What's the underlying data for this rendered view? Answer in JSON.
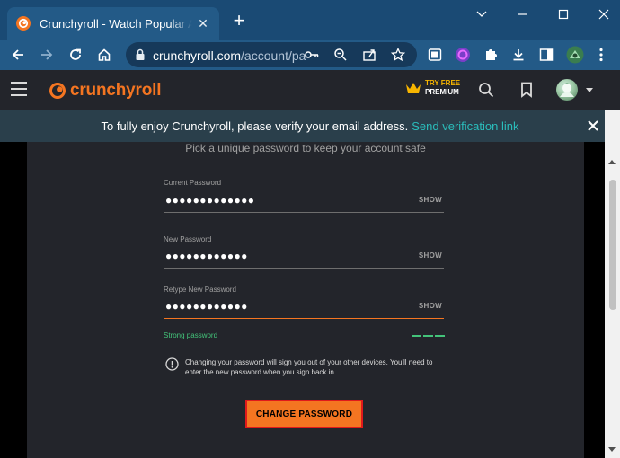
{
  "browser": {
    "tab": {
      "title": "Crunchyroll - Watch Popular Anime",
      "close_glyph": "✕",
      "favicon": "crunchyroll-favicon"
    },
    "new_tab_glyph": "+",
    "url": {
      "host": "crunchyroll.com",
      "path": "/account/password"
    },
    "window_controls": [
      "chevron-down-icon",
      "minimize-icon",
      "maximize-icon",
      "close-icon"
    ],
    "toolbar_icons": [
      "back-icon",
      "forward-icon",
      "reload-icon",
      "home-icon"
    ],
    "omnibox_icons": [
      "key-icon",
      "zoom-icon",
      "share-icon",
      "bookmark-star-icon"
    ],
    "extension_icons": [
      "extension-icon",
      "extension-purple-icon",
      "puzzle-icon",
      "download-icon",
      "sidepanel-icon",
      "profile-icon",
      "kebab-menu-icon"
    ],
    "colors": {
      "frame": "#1a4a74",
      "toolbar": "#235a87",
      "omnibox": "#16395a"
    }
  },
  "site": {
    "brand": "crunchyroll",
    "try_free_line1": "TRY FREE",
    "try_free_line2": "PREMIUM",
    "colors": {
      "accent": "#f47521",
      "header_bg": "#23252b",
      "premium": "#f7b500"
    }
  },
  "banner": {
    "text": "To fully enjoy Crunchyroll, please verify your email address.",
    "link": "Send verification link",
    "link_color": "#2abdbb"
  },
  "form": {
    "subtitle": "Pick a unique password to keep your account safe",
    "fields": [
      {
        "label": "Current Password",
        "value": "●●●●●●●●●●●●●",
        "toggle": "SHOW"
      },
      {
        "label": "New Password",
        "value": "●●●●●●●●●●●●",
        "toggle": "SHOW"
      },
      {
        "label": "Retype New Password",
        "value": "●●●●●●●●●●●●",
        "toggle": "SHOW"
      }
    ],
    "strength_label": "Strong password",
    "strength_color": "#43c47a",
    "info_text": "Changing your password will sign you out of your other devices. You'll need to enter the new password when you sign back in.",
    "submit_label": "CHANGE PASSWORD",
    "highlight_color": "#e0191b"
  }
}
